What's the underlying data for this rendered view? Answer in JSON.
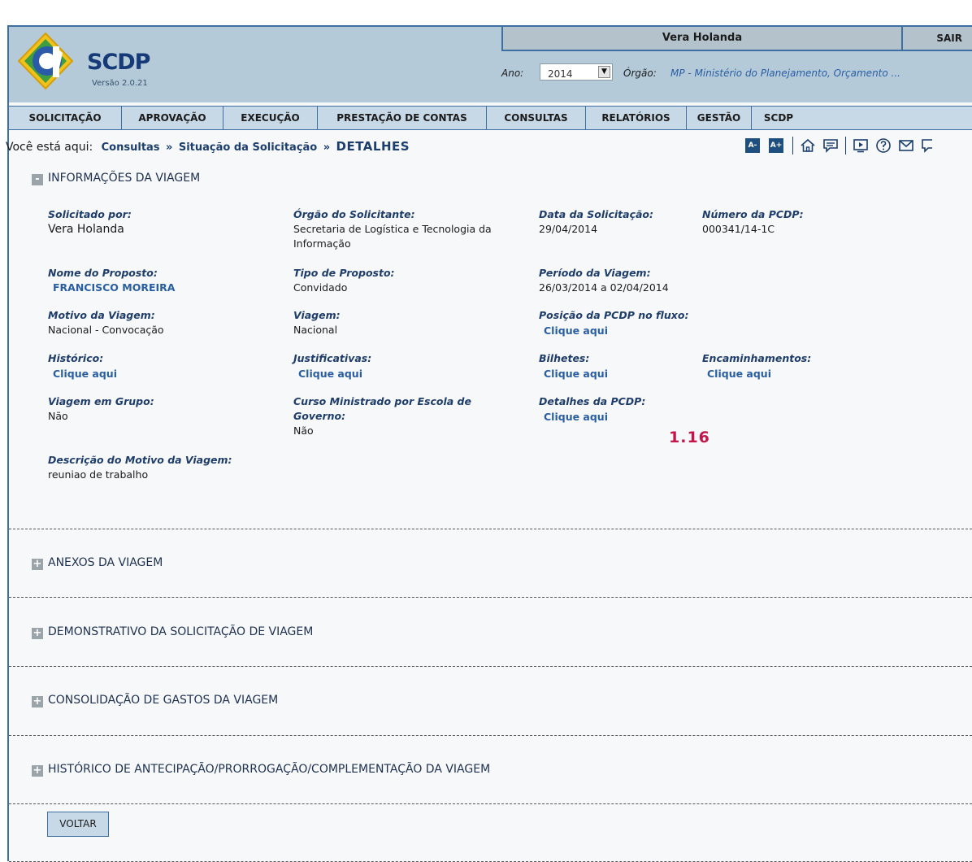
{
  "header": {
    "logo_text": "SCDP",
    "version": "Versão 2.0.21",
    "username": "Vera Holanda",
    "logout": "SAIR",
    "ano_label": "Ano:",
    "ano_value": "2014",
    "orgao_label": "Órgão:",
    "orgao_value": "MP - Ministério do Planejamento, Orçamento ..."
  },
  "menu": [
    {
      "label": "SOLICITAÇÃO"
    },
    {
      "label": "APROVAÇÃO"
    },
    {
      "label": "EXECUÇÃO"
    },
    {
      "label": "PRESTAÇÃO DE CONTAS"
    },
    {
      "label": "CONSULTAS"
    },
    {
      "label": "RELATÓRIOS"
    },
    {
      "label": "GESTÃO"
    },
    {
      "label": "SCDP"
    }
  ],
  "breadcrumb": {
    "prefix": "Você está aqui:",
    "items": [
      "Consultas",
      "Situação da Solicitação"
    ],
    "separator": "»",
    "current": "DETALHES"
  },
  "tools": {
    "font_decrease": "A-",
    "font_increase": "A+",
    "icons": [
      "home-icon",
      "chat-icon",
      "video-icon",
      "help-icon",
      "mail-icon",
      "comment-icon"
    ]
  },
  "sections": {
    "info": {
      "title": "INFORMAÇÕES DA VIAGEM",
      "toggle": "-"
    },
    "anexos": {
      "title": "ANEXOS DA VIAGEM",
      "toggle": "+"
    },
    "demonstrativo": {
      "title": "DEMONSTRATIVO DA SOLICITAÇÃO DE VIAGEM",
      "toggle": "+"
    },
    "consolidacao": {
      "title": "CONSOLIDAÇÃO DE GASTOS DA VIAGEM",
      "toggle": "+"
    },
    "historico_antecipacao": {
      "title": "HISTÓRICO DE ANTECIPAÇÃO/PRORROGAÇÃO/COMPLEMENTAÇÃO DA VIAGEM",
      "toggle": "+"
    }
  },
  "fields": {
    "solicitado_por": {
      "label": "Solicitado por:",
      "value": "Vera Holanda"
    },
    "orgao_solicitante": {
      "label": "Órgão do Solicitante:",
      "value": "Secretaria de Logística e Tecnologia da Informação"
    },
    "data_solicitacao": {
      "label": "Data da Solicitação:",
      "value": "29/04/2014"
    },
    "numero_pcdp": {
      "label": "Número da PCDP:",
      "value": "000341/14-1C"
    },
    "nome_proposto": {
      "label": "Nome do Proposto:",
      "value": "FRANCISCO MOREIRA"
    },
    "tipo_proposto": {
      "label": "Tipo de Proposto:",
      "value": "Convidado"
    },
    "periodo_viagem": {
      "label": "Período da Viagem:",
      "value": "26/03/2014 a 02/04/2014"
    },
    "motivo_viagem": {
      "label": "Motivo da Viagem:",
      "value": "Nacional - Convocação"
    },
    "viagem": {
      "label": "Viagem:",
      "value": "Nacional"
    },
    "posicao_pcdp": {
      "label": "Posição da PCDP no fluxo:",
      "link": "Clique aqui"
    },
    "historico": {
      "label": "Histórico:",
      "link": "Clique aqui"
    },
    "justificativas": {
      "label": "Justificativas:",
      "link": "Clique aqui"
    },
    "bilhetes": {
      "label": "Bilhetes:",
      "link": "Clique aqui"
    },
    "encaminhamentos": {
      "label": "Encaminhamentos:",
      "link": "Clique aqui"
    },
    "viagem_grupo": {
      "label": "Viagem em Grupo:",
      "value": "Não"
    },
    "curso_ministrado": {
      "label": "Curso Ministrado por Escola de Governo:",
      "value": "Não"
    },
    "detalhes_pcdp": {
      "label": "Detalhes da PCDP:",
      "link": "Clique aqui"
    },
    "descricao_motivo": {
      "label": "Descrição do Motivo da Viagem:",
      "value": "reuniao de trabalho"
    }
  },
  "annotation": "1.16",
  "buttons": {
    "voltar": "VOLTAR"
  },
  "colors": {
    "header_bg": "#b4cad9",
    "menu_bg": "#c7d8e6",
    "border": "#3d6fa3",
    "link": "#2a5ea3",
    "annotation": "#c4164a"
  }
}
